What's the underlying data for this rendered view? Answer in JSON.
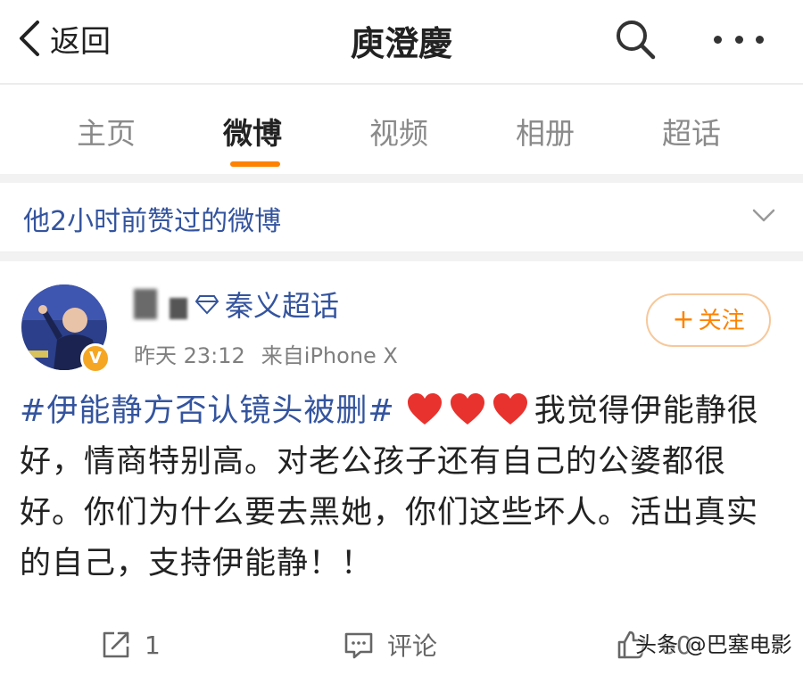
{
  "navbar": {
    "back_label": "返回",
    "title": "庾澄慶",
    "icons": {
      "back": "chevron-left-icon",
      "search": "search-icon",
      "more": "more-dots-icon"
    }
  },
  "tabs": [
    {
      "label": "主页",
      "active": false
    },
    {
      "label": "微博",
      "active": true
    },
    {
      "label": "视频",
      "active": false
    },
    {
      "label": "相册",
      "active": false
    },
    {
      "label": "超话",
      "active": false
    }
  ],
  "liked_banner": {
    "text": "他2小时前赞过的微博",
    "icon": "chevron-down-icon"
  },
  "post": {
    "topic_link": "秦义超话",
    "verified_badge": "V",
    "time": "昨天 23:12",
    "source": "来自iPhone X",
    "follow_label": "关注",
    "hashtag": "#伊能静方否认镜头被删#",
    "hearts": 3,
    "body": "我觉得伊能静很好，情商特别高。对老公孩子还有自己的公婆都很好。你们为什么要去黑她，你们这些坏人。活出真实的自己，支持伊能静！！",
    "actions": {
      "repost_count": "1",
      "comment_label": "评论",
      "like_count": "60"
    }
  },
  "watermark": "头条 @巴塞电影",
  "colors": {
    "accent_orange": "#ff8200",
    "link_blue": "#34549e",
    "heart_red": "#e8322d"
  }
}
